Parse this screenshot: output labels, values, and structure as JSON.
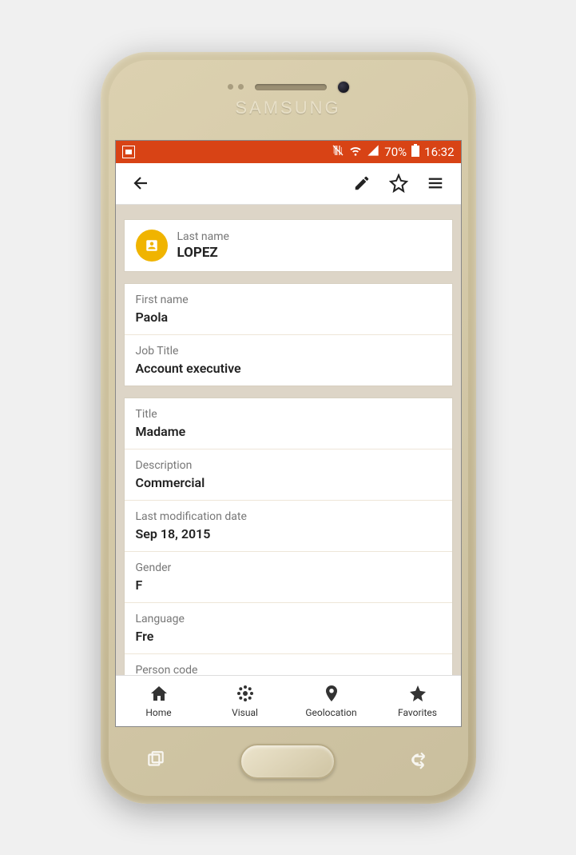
{
  "brand": "SAMSUNG",
  "status": {
    "battery_pct": "70%",
    "time": "16:32"
  },
  "contact": {
    "last_name_label": "Last name",
    "last_name": "LOPEZ",
    "first_name_label": "First name",
    "first_name": "Paola",
    "job_title_label": "Job Title",
    "job_title": "Account executive",
    "title_label": "Title",
    "title": "Madame",
    "description_label": "Description",
    "description": "Commercial",
    "last_mod_label": "Last modification date",
    "last_mod": "Sep 18, 2015",
    "gender_label": "Gender",
    "gender": "F",
    "language_label": "Language",
    "language": "Fre",
    "person_code_label": "Person code"
  },
  "nav": {
    "home": "Home",
    "visual": "Visual",
    "geo": "Geolocation",
    "fav": "Favorites"
  }
}
